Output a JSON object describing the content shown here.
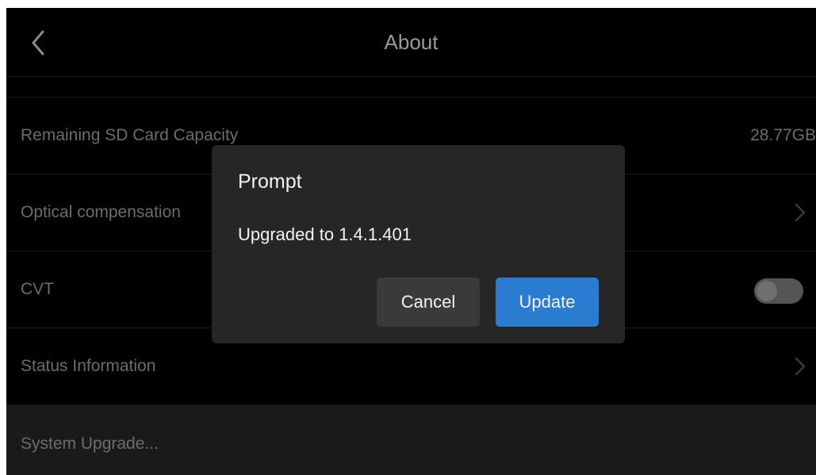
{
  "header": {
    "title": "About"
  },
  "settings": {
    "items": [
      {
        "label": "Remaining SD Card Capacity",
        "value": "28.77GB"
      },
      {
        "label": "Optical compensation"
      },
      {
        "label": "CVT",
        "toggle_on": false
      },
      {
        "label": "Status Information"
      },
      {
        "label": "System Upgrade..."
      }
    ]
  },
  "dialog": {
    "title": "Prompt",
    "message": "Upgraded to 1.4.1.401",
    "cancel_label": "Cancel",
    "confirm_label": "Update"
  },
  "colors": {
    "background": "#000000",
    "dialog_bg": "#262626",
    "accent": "#2b7bd0",
    "secondary_button": "#3a3a3a"
  },
  "icons": {
    "back": "chevron-left-icon",
    "row_arrow": "chevron-right-icon"
  }
}
